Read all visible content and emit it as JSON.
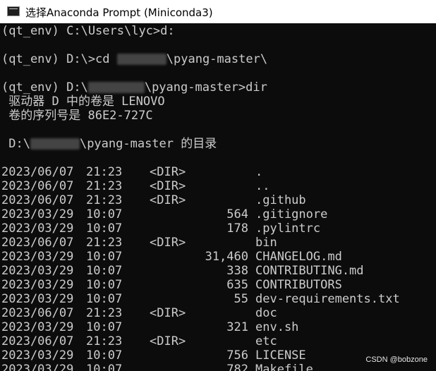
{
  "window": {
    "title": "选择Anaconda Prompt (Miniconda3)"
  },
  "console": {
    "lines": [
      {
        "text": "(qt_env) C:\\Users\\lyc>d:"
      },
      {
        "text": ""
      },
      {
        "prefix": "(qt_env) D:\\>cd ",
        "suffix": "\\pyang-master\\"
      },
      {
        "text": ""
      },
      {
        "prefix": "(qt_env) D:\\",
        "suffix": "\\pyang-master>dir"
      },
      {
        "text": " 驱动器 D 中的卷是 LENOVO"
      },
      {
        "text": " 卷的序列号是 86E2-727C"
      },
      {
        "text": ""
      },
      {
        "prefix": " D:\\",
        "suffix": "\\pyang-master 的目录"
      },
      {
        "text": ""
      }
    ],
    "listing": [
      {
        "date": "2023/06/07",
        "time": "21:23",
        "dir": "<DIR>",
        "size": "",
        "name": "."
      },
      {
        "date": "2023/06/07",
        "time": "21:23",
        "dir": "<DIR>",
        "size": "",
        "name": ".."
      },
      {
        "date": "2023/06/07",
        "time": "21:23",
        "dir": "<DIR>",
        "size": "",
        "name": ".github"
      },
      {
        "date": "2023/03/29",
        "time": "10:07",
        "dir": "",
        "size": "564",
        "name": ".gitignore"
      },
      {
        "date": "2023/03/29",
        "time": "10:07",
        "dir": "",
        "size": "178",
        "name": ".pylintrc"
      },
      {
        "date": "2023/06/07",
        "time": "21:23",
        "dir": "<DIR>",
        "size": "",
        "name": "bin"
      },
      {
        "date": "2023/03/29",
        "time": "10:07",
        "dir": "",
        "size": "31,460",
        "name": "CHANGELOG.md"
      },
      {
        "date": "2023/03/29",
        "time": "10:07",
        "dir": "",
        "size": "338",
        "name": "CONTRIBUTING.md"
      },
      {
        "date": "2023/03/29",
        "time": "10:07",
        "dir": "",
        "size": "635",
        "name": "CONTRIBUTORS"
      },
      {
        "date": "2023/03/29",
        "time": "10:07",
        "dir": "",
        "size": "55",
        "name": "dev-requirements.txt"
      },
      {
        "date": "2023/06/07",
        "time": "21:23",
        "dir": "<DIR>",
        "size": "",
        "name": "doc"
      },
      {
        "date": "2023/03/29",
        "time": "10:07",
        "dir": "",
        "size": "321",
        "name": "env.sh"
      },
      {
        "date": "2023/06/07",
        "time": "21:23",
        "dir": "<DIR>",
        "size": "",
        "name": "etc"
      },
      {
        "date": "2023/03/29",
        "time": "10:07",
        "dir": "",
        "size": "756",
        "name": "LICENSE"
      },
      {
        "date": "2023/03/29",
        "time": "10:07",
        "dir": "",
        "size": "782",
        "name": "Makefile"
      }
    ]
  },
  "watermark": "CSDN @bobzone",
  "icons": {
    "app": "terminal-icon"
  },
  "colors": {
    "console_bg": "#0c0c0c",
    "console_fg": "#cccccc",
    "titlebar_bg": "#ffffff"
  }
}
